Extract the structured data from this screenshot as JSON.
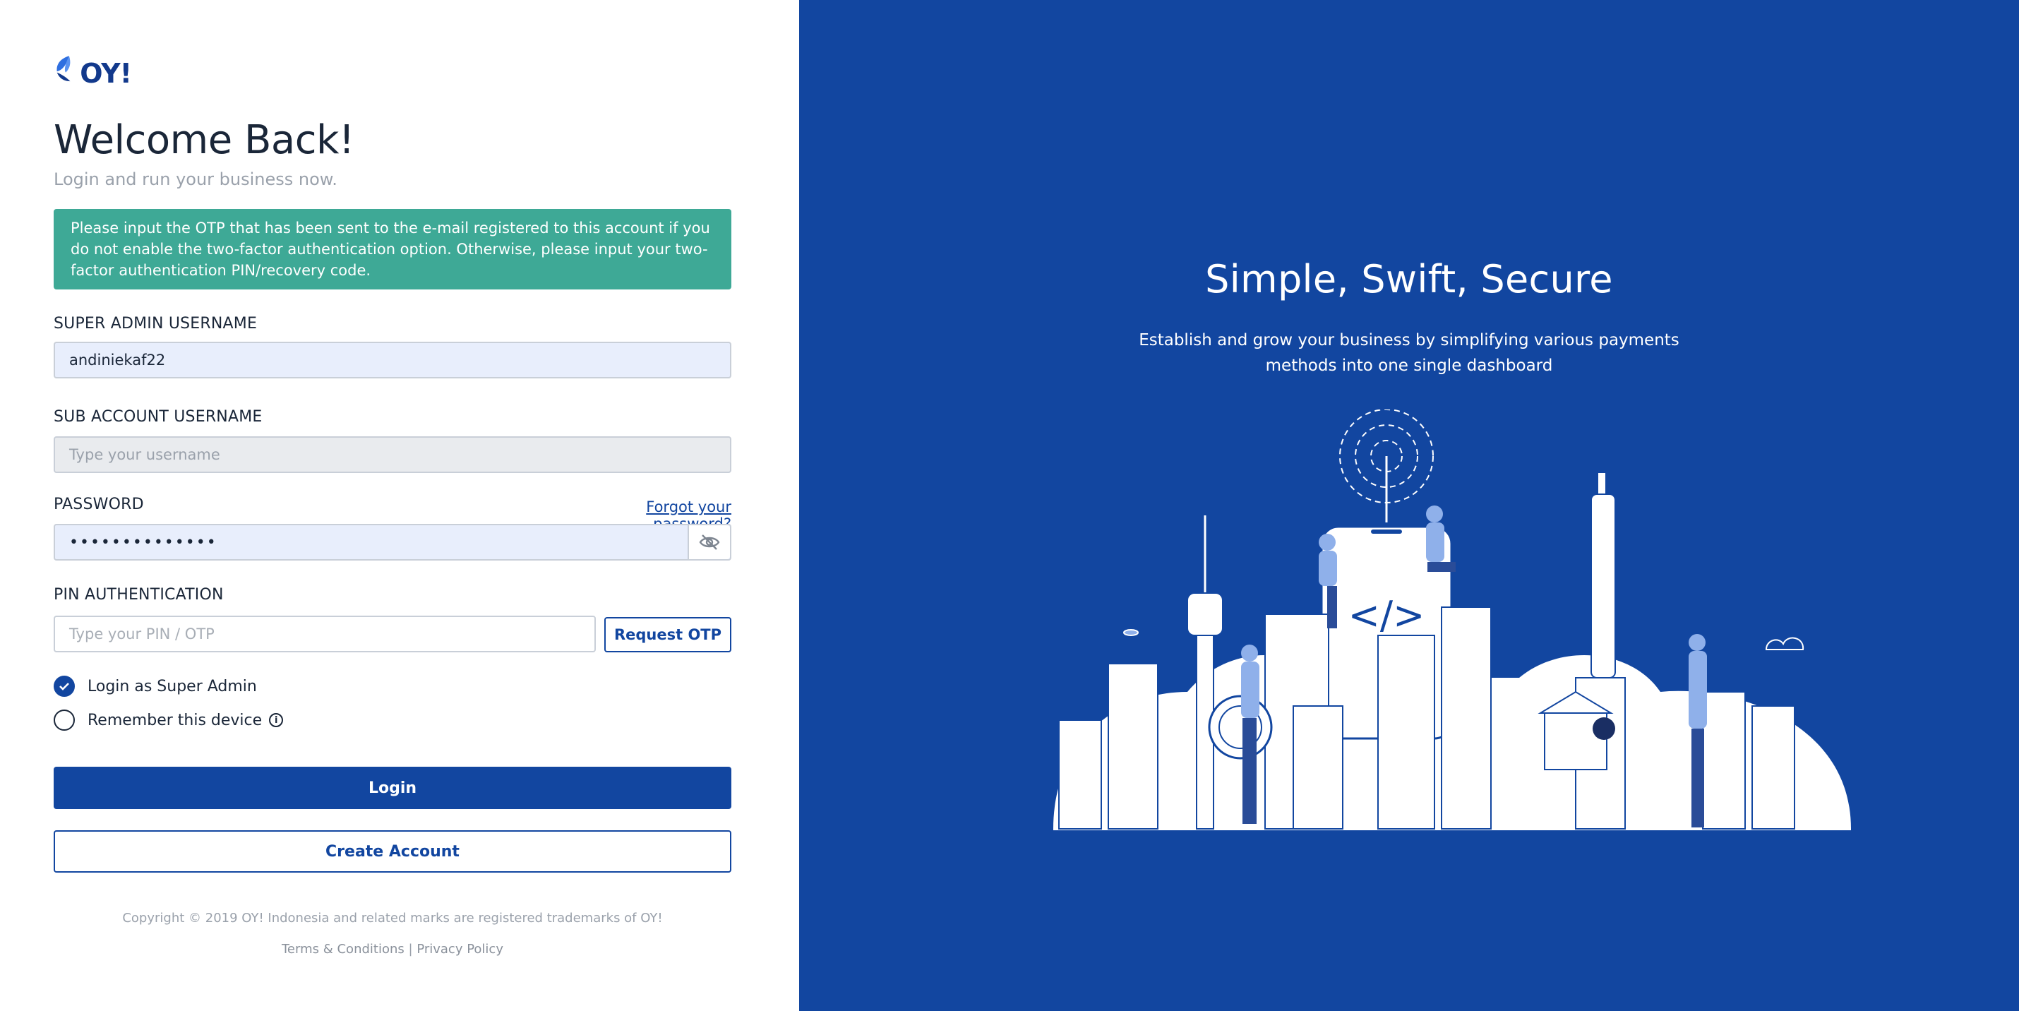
{
  "brand": {
    "name": "OY!",
    "primary_color": "#1246a0",
    "alert_color": "#3ea996"
  },
  "login": {
    "title": "Welcome Back!",
    "subtitle": "Login and run your business now.",
    "alert": "Please input the OTP that has been sent to the e-mail registered to this account if you do not enable the two-factor authentication option. Otherwise, please input your two-factor authentication PIN/recovery code.",
    "super_admin_label": "SUPER ADMIN USERNAME",
    "super_admin_value": "andiniekaf22",
    "sub_account_label": "SUB ACCOUNT USERNAME",
    "sub_account_placeholder": "Type your username",
    "password_label": "PASSWORD",
    "forgot_password": "Forgot your password?",
    "password_value": "••••••••••••••",
    "pin_label": "PIN AUTHENTICATION",
    "pin_placeholder": "Type your PIN / OTP",
    "request_otp": "Request OTP",
    "login_as_super_admin": "Login as Super Admin",
    "login_as_super_admin_checked": true,
    "remember_device": "Remember this device",
    "remember_device_checked": false,
    "login_button": "Login",
    "create_account_button": "Create Account"
  },
  "footer": {
    "copyright": "Copyright © 2019 OY! Indonesia and related marks are registered trademarks of OY!",
    "terms": "Terms & Conditions",
    "separator": "|",
    "privacy": "Privacy Policy"
  },
  "hero": {
    "title": "Simple, Swift, Secure",
    "text": "Establish and grow your business by simplifying various payments methods into one single dashboard"
  }
}
